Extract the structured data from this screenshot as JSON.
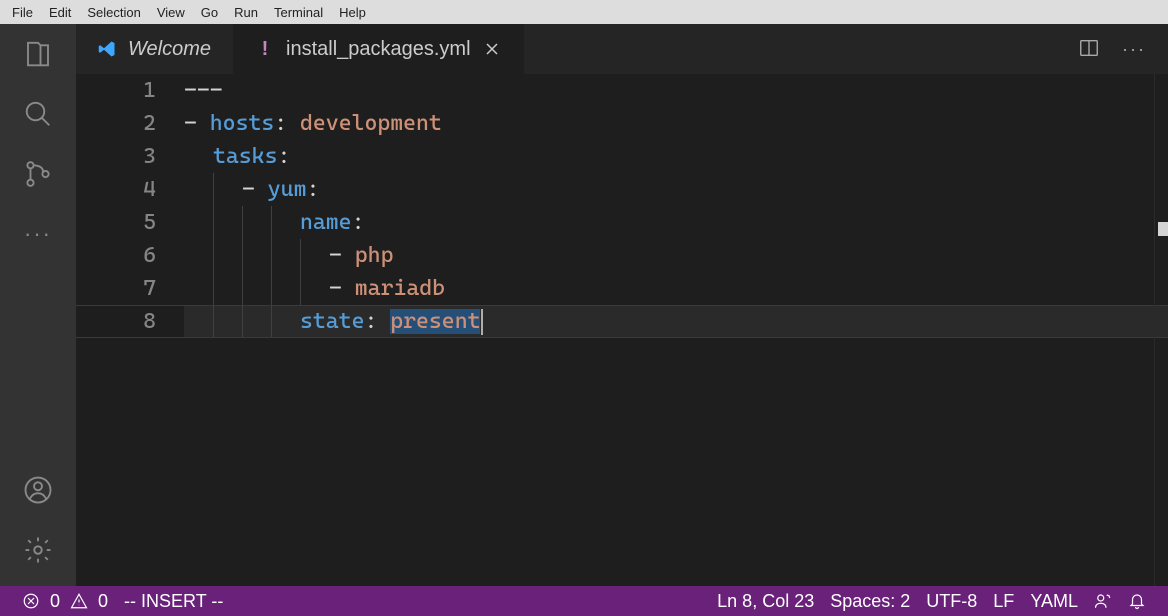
{
  "menubar": [
    "File",
    "Edit",
    "Selection",
    "View",
    "Go",
    "Run",
    "Terminal",
    "Help"
  ],
  "tabs": [
    {
      "title": "Welcome",
      "active": false
    },
    {
      "title": "install_packages.yml",
      "active": true
    }
  ],
  "editor": {
    "lines": [
      {
        "n": 1,
        "segments": [
          {
            "t": "---",
            "c": "tk-dash"
          }
        ],
        "indent": 0
      },
      {
        "n": 2,
        "segments": [
          {
            "t": "- ",
            "c": "tk-dash"
          },
          {
            "t": "hosts",
            "c": "tk-key"
          },
          {
            "t": ": ",
            "c": "tk-colon"
          },
          {
            "t": "development",
            "c": "tk-val"
          }
        ],
        "indent": 0
      },
      {
        "n": 3,
        "segments": [
          {
            "t": "tasks",
            "c": "tk-key"
          },
          {
            "t": ":",
            "c": "tk-colon"
          }
        ],
        "indent": 1
      },
      {
        "n": 4,
        "segments": [
          {
            "t": "- ",
            "c": "tk-dash"
          },
          {
            "t": "yum",
            "c": "tk-key"
          },
          {
            "t": ":",
            "c": "tk-colon"
          }
        ],
        "indent": 2
      },
      {
        "n": 5,
        "segments": [
          {
            "t": "name",
            "c": "tk-key"
          },
          {
            "t": ":",
            "c": "tk-colon"
          }
        ],
        "indent": 4
      },
      {
        "n": 6,
        "segments": [
          {
            "t": "- ",
            "c": "tk-dash"
          },
          {
            "t": "php",
            "c": "tk-val"
          }
        ],
        "indent": 5
      },
      {
        "n": 7,
        "segments": [
          {
            "t": "- ",
            "c": "tk-dash"
          },
          {
            "t": "mariadb",
            "c": "tk-val"
          }
        ],
        "indent": 5
      },
      {
        "n": 8,
        "segments": [
          {
            "t": "state",
            "c": "tk-key"
          },
          {
            "t": ": ",
            "c": "tk-colon"
          },
          {
            "t": "present",
            "c": "tk-val",
            "hl": true
          }
        ],
        "indent": 4,
        "current": true
      }
    ]
  },
  "status": {
    "errors": "0",
    "warnings": "0",
    "vim": "-- INSERT --",
    "pos": "Ln 8, Col 23",
    "spaces": "Spaces: 2",
    "encoding": "UTF-8",
    "eol": "LF",
    "lang": "YAML"
  }
}
